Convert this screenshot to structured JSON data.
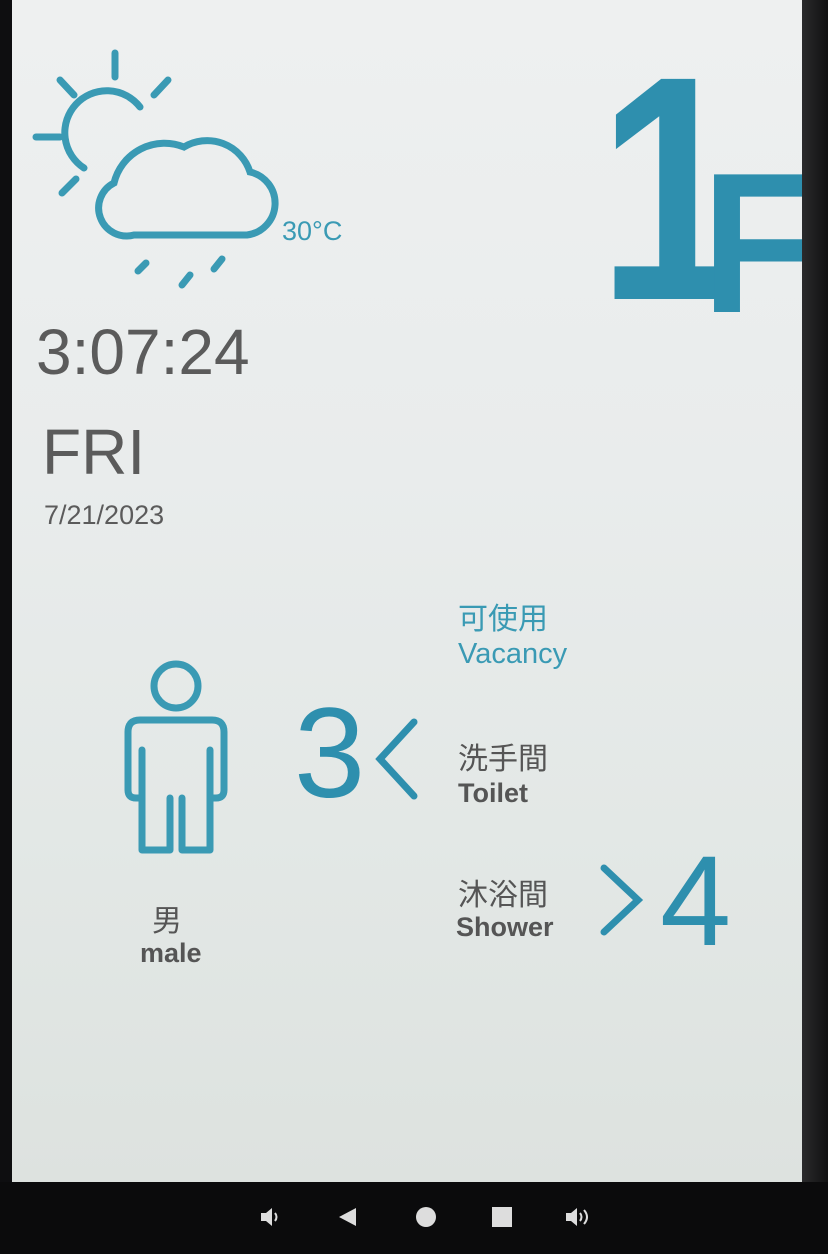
{
  "weather": {
    "icon": "partly-cloudy-rain-icon",
    "temperature": "30°C"
  },
  "floor": {
    "number": "1",
    "unit": "F"
  },
  "clock": {
    "time": "3:07:24",
    "day": "FRI",
    "date": "7/21/2023"
  },
  "restroom": {
    "gender_cn": "男",
    "gender_en": "male",
    "left_count": "3",
    "right_count": "4"
  },
  "legend": {
    "vacancy_cn": "可使用",
    "vacancy_en": "Vacancy",
    "toilet_cn": "洗手間",
    "toilet_en": "Toilet",
    "shower_cn": "沐浴間",
    "shower_en": "Shower"
  },
  "navbar": {
    "buttons": [
      "volume-down-icon",
      "back-icon",
      "home-icon",
      "recents-icon",
      "volume-up-icon"
    ]
  },
  "colors": {
    "accent": "#2e8fae",
    "text": "#5b5b5b",
    "screen_bg": "#eceeee"
  }
}
